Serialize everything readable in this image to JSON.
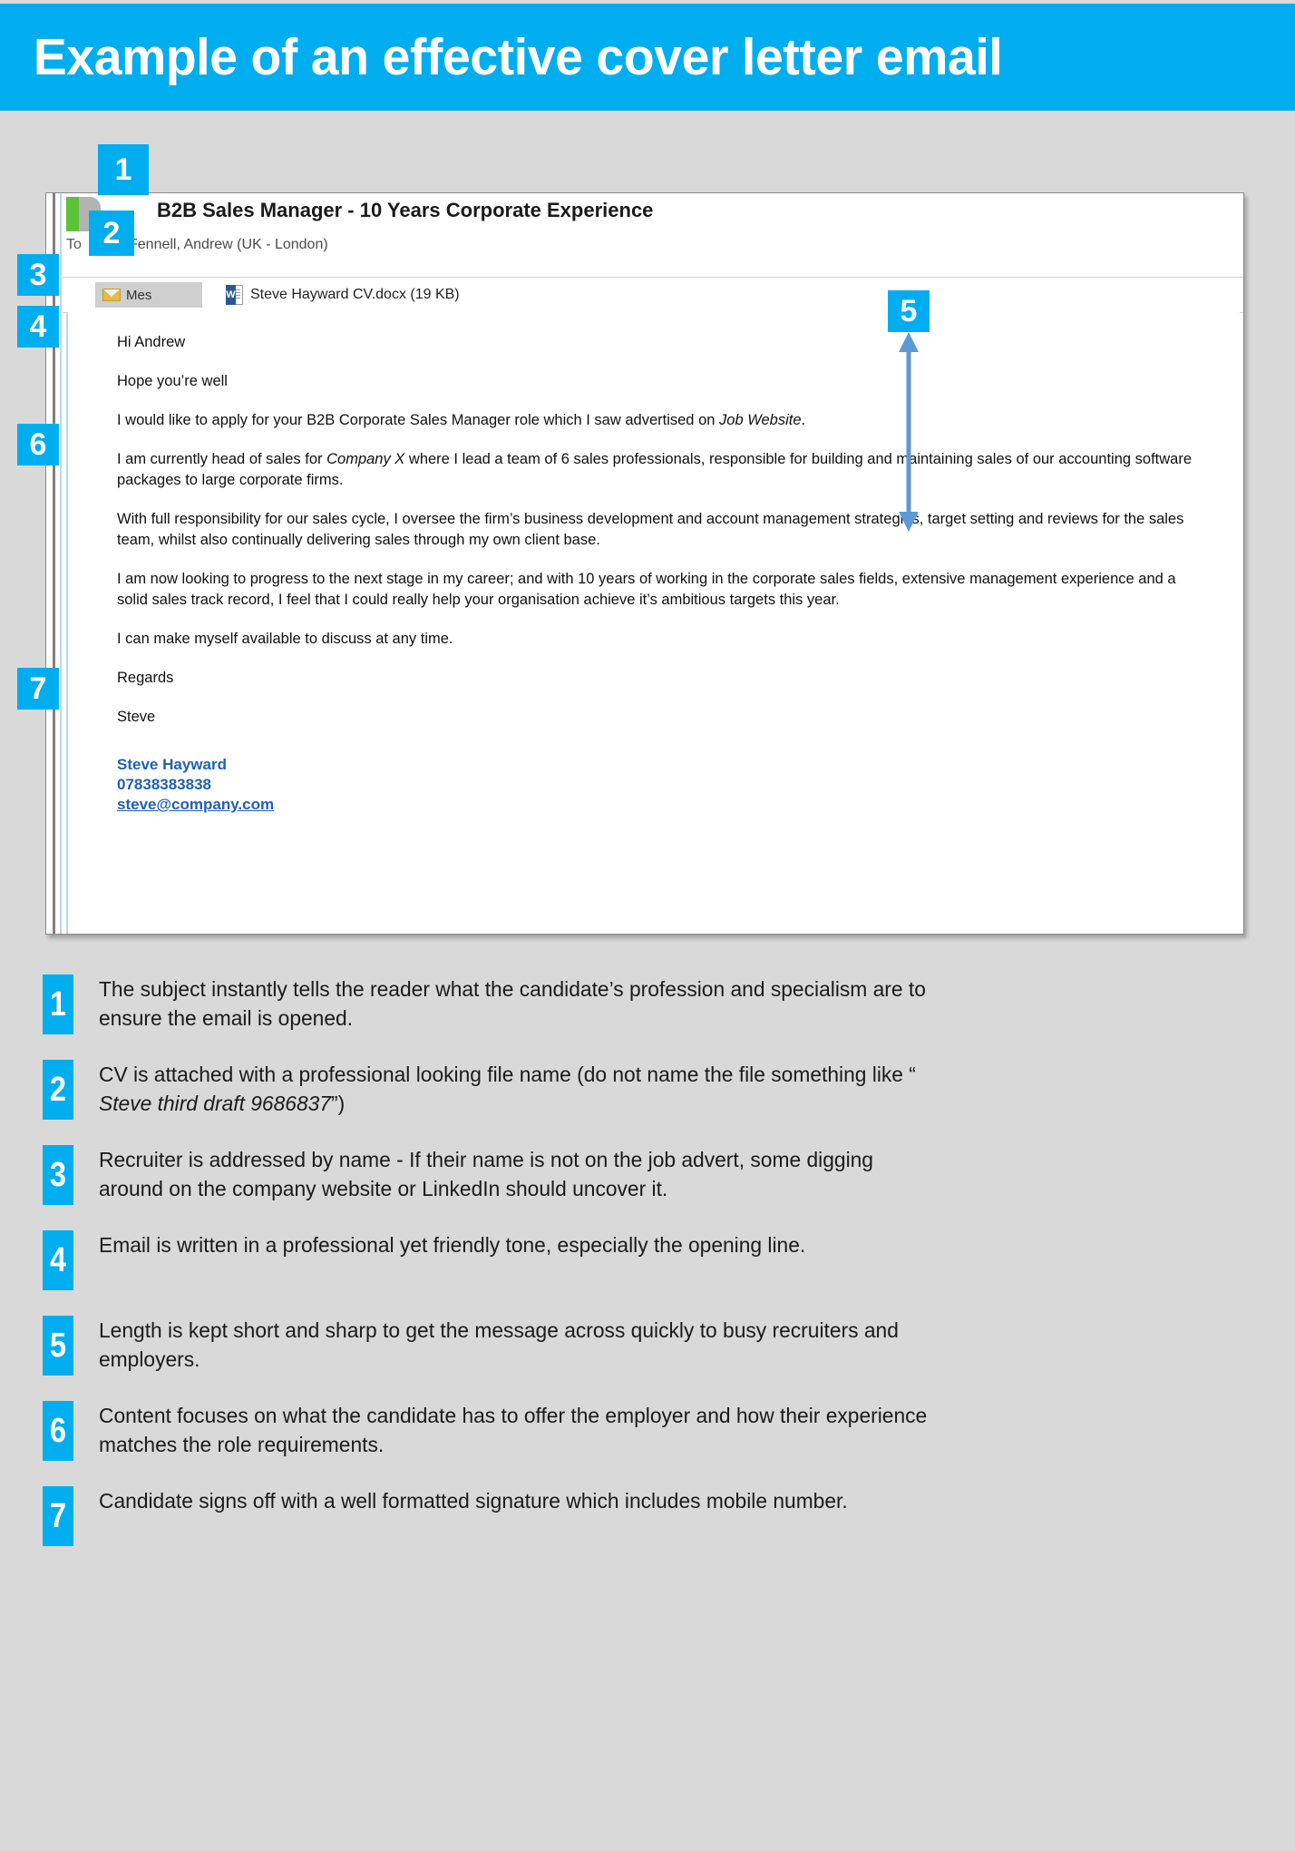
{
  "header": {
    "title": "Example of an effective cover letter email",
    "background_color": "#00aeef",
    "text_color": "#ffffff"
  },
  "email": {
    "subject": "B2B Sales Manager - 10 Years Corporate Experience",
    "to_label": "To",
    "to_recipient": "Fennell, Andrew (UK - London)",
    "message_tab_label": "Mes",
    "attachment": "Steve Hayward CV.docx (19 KB)",
    "attachment_icon": "word-document-icon",
    "envelope_icon": "envelope-icon",
    "presence_icon": "presence-available-icon",
    "body": {
      "greeting": "Hi Andrew",
      "opening": "Hope you’re well",
      "paragraph_1_before": "I would like to apply for your B2B Corporate Sales Manager role which I saw advertised on ",
      "paragraph_1_italic": "Job Website",
      "paragraph_1_after": ".",
      "paragraph_2_before": "I am currently head of sales for ",
      "paragraph_2_italic": "Company X",
      "paragraph_2_after": " where I lead a team of 6 sales professionals, responsible for building and maintaining sales of our accounting software packages to large corporate firms.",
      "paragraph_3": "With full responsibility for our sales cycle, I oversee the firm’s business development and account management strategies, target setting and reviews for the sales team, whilst also continually delivering sales through my own client base.",
      "paragraph_4": "I am now looking to progress to the next stage in my career; and with 10 years of working in the corporate sales fields, extensive management experience and a solid sales track record, I feel that I could really help your organisation achieve it’s ambitious targets this year.",
      "paragraph_5": "I can make myself available to discuss at any time.",
      "sign_off": "Regards",
      "sign_name": "Steve",
      "signature_name": "Steve Hayward",
      "signature_phone": "07838383838",
      "signature_email": "steve@company.com"
    }
  },
  "callouts": {
    "overlay": [
      {
        "number": "1"
      },
      {
        "number": "2"
      },
      {
        "number": "3"
      },
      {
        "number": "4"
      },
      {
        "number": "5"
      },
      {
        "number": "6"
      },
      {
        "number": "7"
      }
    ],
    "arrow_icon": "double-headed-vertical-arrow-icon",
    "arrow_color": "#5b9bd5",
    "badge_color": "#00aeef"
  },
  "notes": [
    {
      "number": "1",
      "text": "The subject instantly tells the reader what the candidate’s profession and specialism are to ensure the email is opened."
    },
    {
      "number": "2",
      "text_before": "CV is attached with a professional looking file name (do not name the file something like “ ",
      "text_italic": "Steve third draft 9686837",
      "text_after": "”)"
    },
    {
      "number": "3",
      "text": "Recruiter is addressed by name - If their name is not on the job advert, some digging around on the company website or LinkedIn should uncover it."
    },
    {
      "number": "4",
      "text": "Email is written in a professional yet friendly tone, especially the opening line."
    },
    {
      "number": "5",
      "text": "Length is kept short and sharp to get the message across quickly to busy recruiters and employers."
    },
    {
      "number": "6",
      "text": "Content focuses on what the candidate has to offer the employer and how their experience matches the role requirements."
    },
    {
      "number": "7",
      "text": "Candidate signs off with a well formatted signature which includes mobile number."
    }
  ]
}
